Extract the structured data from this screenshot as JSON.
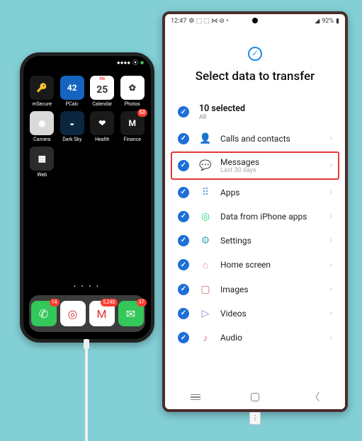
{
  "iphone": {
    "status": {
      "signal": "●●●●",
      "wifi": "⦿",
      "battery": "■"
    },
    "apps": [
      {
        "name": "mSecure",
        "icon": "🔑",
        "bg": "#1a1a1a",
        "badge": ""
      },
      {
        "name": "PCalc",
        "icon": "42",
        "bg": "#1565c0",
        "badge": ""
      },
      {
        "name": "Calendar",
        "icon": "25",
        "bg": "#ffffff",
        "badge": "",
        "top": "FRI"
      },
      {
        "name": "Photos",
        "icon": "✿",
        "bg": "#ffffff",
        "badge": ""
      },
      {
        "name": "Camera",
        "icon": "◉",
        "bg": "#d9d9d9",
        "badge": ""
      },
      {
        "name": "Dark Sky",
        "icon": "◒",
        "bg": "#0b2740",
        "badge": ""
      },
      {
        "name": "Health",
        "icon": "❤",
        "bg": "#1a1a1a",
        "badge": ""
      },
      {
        "name": "Finance",
        "icon": "M",
        "bg": "#1a1a1a",
        "badge": "53"
      },
      {
        "name": "Web",
        "icon": "▦",
        "bg": "#2b2b2b",
        "badge": ""
      }
    ],
    "dock": [
      {
        "name": "Phone",
        "bg": "#34c759",
        "badge": "14",
        "icon": "✆"
      },
      {
        "name": "Chrome",
        "bg": "#ffffff",
        "badge": "",
        "icon": "◎"
      },
      {
        "name": "Gmail",
        "bg": "#ffffff",
        "badge": "5,240",
        "icon": "M"
      },
      {
        "name": "Messages",
        "bg": "#34c759",
        "badge": "37",
        "icon": "✉"
      }
    ],
    "page_dots": "• • • •"
  },
  "android": {
    "status": {
      "time": "12:47",
      "left_icons": "⚙ ⬚ ⬚ ⋈ ⊘ •",
      "right_signal": "◢",
      "battery_pct": "92%",
      "battery_icon": "▮"
    },
    "header_icon": "✓",
    "title": "Select data to transfer",
    "select_all": {
      "count_label": "10 selected",
      "sub_label": "All"
    },
    "items": [
      {
        "id": "calls",
        "label": "Calls and contacts",
        "sub": "",
        "icon": "👤",
        "hclass": "i-person",
        "highlight": false
      },
      {
        "id": "messages",
        "label": "Messages",
        "sub": "Last 30 days",
        "icon": "💬",
        "hclass": "i-msg",
        "highlight": true
      },
      {
        "id": "apps",
        "label": "Apps",
        "sub": "",
        "icon": "⠿",
        "hclass": "i-apps",
        "highlight": false
      },
      {
        "id": "data",
        "label": "Data from iPhone apps",
        "sub": "",
        "icon": "◎",
        "hclass": "i-data",
        "highlight": false
      },
      {
        "id": "settings",
        "label": "Settings",
        "sub": "",
        "icon": "⚙",
        "hclass": "i-settings",
        "highlight": false
      },
      {
        "id": "home",
        "label": "Home screen",
        "sub": "",
        "icon": "⌂",
        "hclass": "i-home",
        "highlight": false
      },
      {
        "id": "images",
        "label": "Images",
        "sub": "",
        "icon": "▢",
        "hclass": "i-images",
        "highlight": false
      },
      {
        "id": "videos",
        "label": "Videos",
        "sub": "",
        "icon": "▷",
        "hclass": "i-videos",
        "highlight": false
      },
      {
        "id": "audio",
        "label": "Audio",
        "sub": "",
        "icon": "♪",
        "hclass": "i-audio",
        "highlight": false
      }
    ],
    "chevron": "›"
  }
}
